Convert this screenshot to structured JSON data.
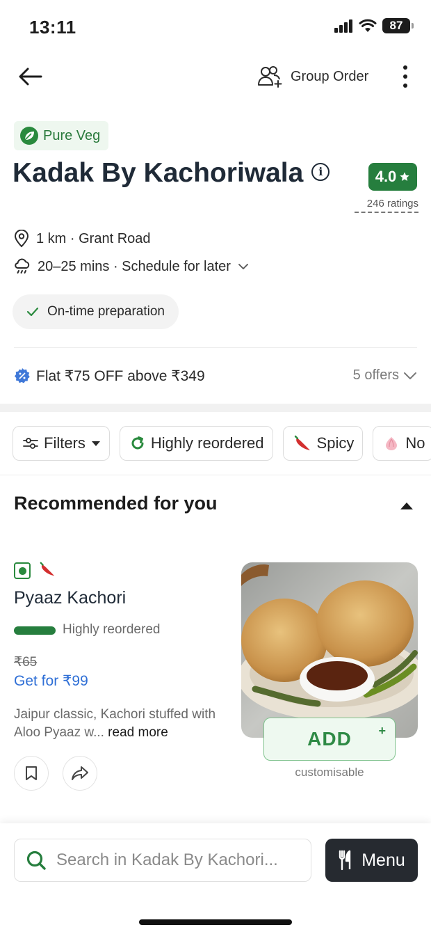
{
  "status_bar": {
    "time": "13:11",
    "battery": "87"
  },
  "nav": {
    "group_order_label": "Group Order"
  },
  "restaurant": {
    "veg_badge": "Pure Veg",
    "name": "Kadak By Kachoriwala",
    "rating": "4.0",
    "rating_count": "246 ratings",
    "location": "1 km · Grant Road",
    "delivery_time": "20–25 mins · Schedule for later",
    "chip": "On-time preparation"
  },
  "offer": {
    "text": "Flat ₹75 OFF above ₹349",
    "count": "5 offers"
  },
  "filters": {
    "filters_label": "Filters",
    "highly_reordered_label": "Highly reordered",
    "spicy_label": "Spicy",
    "next_label": "No"
  },
  "section": {
    "title": "Recommended for you"
  },
  "item": {
    "name": "Pyaaz Kachori",
    "tag": "Highly reordered",
    "original_price": "₹65",
    "offer_price": "Get for ₹99",
    "description": "Jaipur classic, Kachori stuffed with Aloo Pyaaz w...",
    "read_more": " read more",
    "add_label": "ADD",
    "add_plus": "+",
    "customisable": "customisable"
  },
  "bottom": {
    "search_placeholder": "Search in Kadak By Kachori...",
    "menu_label": "Menu"
  },
  "colors": {
    "brand_green": "#267e3e",
    "link_blue": "#2f6fd6",
    "dark": "#262a30"
  },
  "icons": [
    "back-arrow-icon",
    "group-order-icon",
    "more-icon",
    "leaf-icon",
    "info-icon",
    "star-icon",
    "location-pin-icon",
    "rain-cloud-icon",
    "chevron-down-icon",
    "check-icon",
    "offer-badge-icon",
    "filter-sliders-icon",
    "caret-down-icon",
    "reorder-icon",
    "chili-icon",
    "onion-icon",
    "caret-up-icon",
    "veg-mark-icon",
    "bookmark-icon",
    "share-icon",
    "search-icon",
    "cutlery-icon"
  ]
}
